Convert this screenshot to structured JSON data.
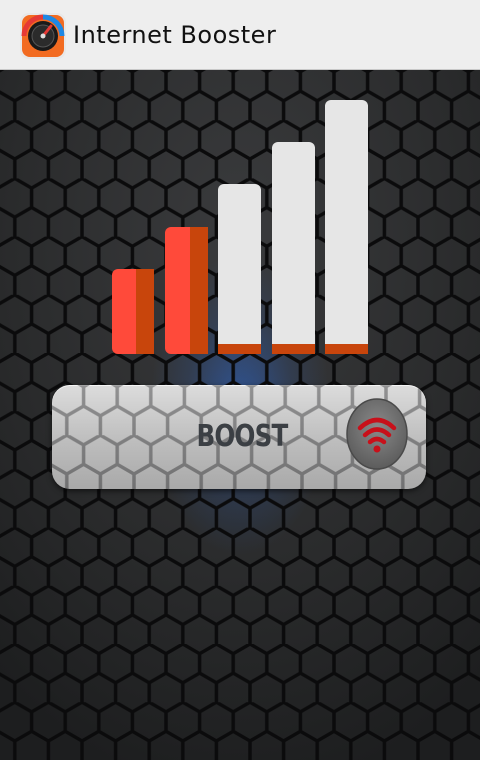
{
  "app": {
    "title": "Internet Booster",
    "icon": "speedometer-icon"
  },
  "signal_meter": {
    "icon": "signal-bars",
    "bars_total": 5,
    "bars_active": 2,
    "colors": {
      "active": "#ff4a3a",
      "active_shade": "#c8450c",
      "inactive": "#e6e6e6",
      "base": "#c8450c"
    }
  },
  "boost": {
    "label": "BOOST",
    "icon": "wifi-icon",
    "icon_color": "#c8101a"
  },
  "colors": {
    "background": "#1c1d1e",
    "hex_stroke": "#0b0b0c",
    "glow": "#2d6ee0",
    "titlebar": "#eeeeee"
  }
}
